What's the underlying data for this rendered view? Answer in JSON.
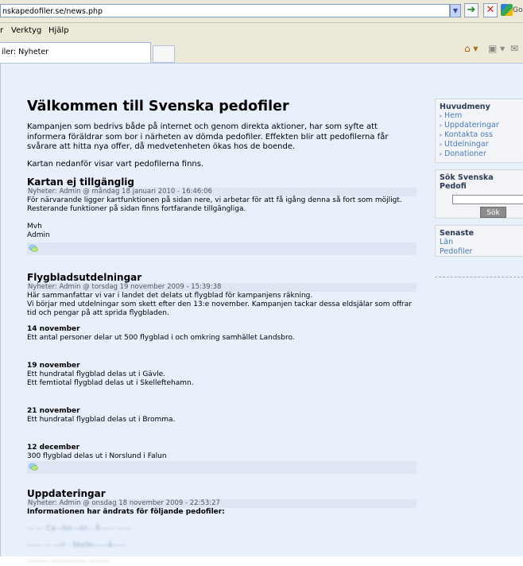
{
  "browser": {
    "address": "nskapedofiler.se/news.php",
    "google_label": "Go",
    "menu": [
      "r",
      "Verktyg",
      "Hjälp"
    ],
    "tab_title": "iler: Nyheter"
  },
  "page": {
    "title": "Välkommen till Svenska pedofiler",
    "intro": [
      "Kampanjen som bedrivs både på internet och genom direkta aktioner, har som syfte att informera föräldrar som bor i närheten av dömda pedofiler. Effekten blir att pedofilerna får svårare att hitta nya offer, då medvetenheten ökas hos de boende.",
      "Kartan nedanför visar vart pedofilerna finns."
    ],
    "posts": [
      {
        "title": "Kartan ej tillgänglig",
        "meta_prefix": "Nyheter: ",
        "author": "Admin",
        "meta_date": " @ måndag 18 januari 2010 - 16:46:06",
        "body": [
          "För närvarande ligger kartfunktionen på sidan nere, vi arbetar för att få igång denna så fort som möjligt. Resterande funktioner på sidan finns fortfarande tillgängliga.",
          "",
          "Mvh",
          "Admin"
        ]
      },
      {
        "title": "Flygbladsutdelningar",
        "meta_prefix": "Nyheter: ",
        "author": "Admin",
        "meta_date": " @ torsdag 19 november 2009 - 15:39:38",
        "intro": [
          "Här sammanfattar vi var i landet det delats ut flygblad för kampanjens räkning.",
          "Vi börjar med utdelningar som skett efter den 13:e november. Kampanjen tackar dessa eldsjälar som offrar tid och pengar på att sprida flygbladen."
        ],
        "entries": [
          {
            "date": "14 november",
            "text": "Ett antal personer delar ut 500 flygblad i och omkring samhället Landsbro."
          },
          {
            "date": "19 november",
            "text": "Ett hundratal flygblad delas ut i Gävle.",
            "text2": "Ett femtiotal flygblad delas ut i Skelleftehamn."
          },
          {
            "date": "21 november",
            "text": "Ett hundratal flygblad delas ut i Bromma."
          },
          {
            "date": "12 december",
            "text": "300 flygblad delas ut i Norslund i Falun"
          }
        ]
      },
      {
        "title": "Uppdateringar",
        "meta_prefix": "Nyheter: ",
        "author": "Admin",
        "meta_date": " @ onsdag 18 november 2009 - 22:53:27",
        "bold_line": "Informationen har ändrats för följande pedofiler:",
        "blurred": [
          "— — Ca—lss—on - Ä—— ——",
          "—— — —ri - Skelle——å——",
          "——— ————— ———"
        ]
      }
    ]
  },
  "sidebar": {
    "menu_title": "Huvudmeny",
    "menu_items": [
      "Hem",
      "Uppdateringar",
      "Kontakta oss",
      "Utdelningar",
      "Donationer"
    ],
    "search_title": "Sök Svenska Pedofi",
    "search_button": "Sök",
    "latest_title": "Senaste",
    "latest_items": [
      "Län",
      "Pedofiler"
    ]
  },
  "colors": {
    "page_bg": "#e8f0fb",
    "meta_bg": "#dde6f2",
    "link": "#4a7ab8"
  }
}
